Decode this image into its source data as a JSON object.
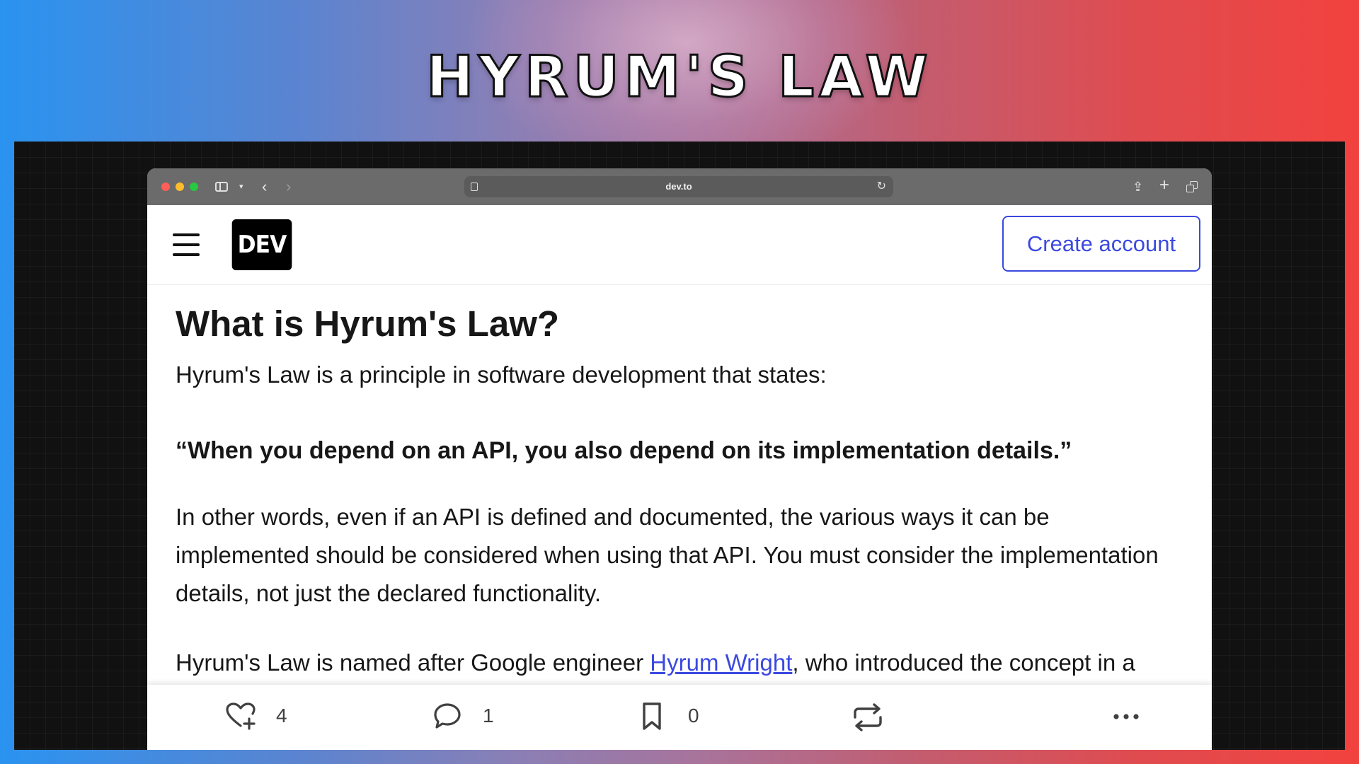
{
  "banner": {
    "title": "HYRUM'S LAW"
  },
  "browser": {
    "address": "dev.to",
    "icons": [
      "sidebar-icon",
      "chevron-down-icon",
      "back-icon",
      "forward-icon",
      "page-icon",
      "reload-icon",
      "share-icon",
      "new-tab-icon",
      "tabs-overview-icon"
    ]
  },
  "header": {
    "logo": "DEV",
    "create_account": "Create account"
  },
  "article": {
    "title": "What is Hyrum's Law?",
    "intro": "Hyrum's Law is a principle in software development that states:",
    "quote": "“When you depend on an API, you also depend on its implementation details.”",
    "paragraph2": "In other words, even if an API is defined and documented, the various ways it can be implemented should be considered when using that API. You must consider the implementation details, not just the declared functionality.",
    "paragraph3_before": "Hyrum's Law is named after Google engineer ",
    "paragraph3_link": "Hyrum Wright",
    "paragraph3_after": ", who introduced the concept in a"
  },
  "actions": {
    "like_count": "4",
    "comment_count": "1",
    "save_count": "0"
  },
  "colors": {
    "accent": "#3b49df",
    "text": "#171717",
    "chrome": "#6b6b6b"
  }
}
